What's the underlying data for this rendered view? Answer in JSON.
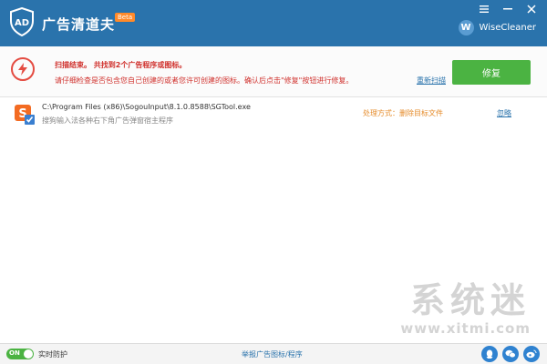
{
  "app": {
    "title": "广告清道夫",
    "badge": "Beta",
    "brand": "WiseCleaner",
    "brand_initial": "W"
  },
  "alert": {
    "headline": "扫描结束。 共找到2个广告程序或图标。",
    "detail": "请仔细检查是否包含您自己创建的或者您许可创建的图标。确认后点击\"修复\"按钮进行修复。",
    "rescan_label": "重新扫描",
    "fix_label": "修复"
  },
  "results": [
    {
      "path": "C:\\Program Files (x86)\\SogouInput\\8.1.0.8588\\SGTool.exe",
      "desc": "搜狗输入法各种右下角广告弹窗宿主程序",
      "action": "处理方式：删除目标文件",
      "ignore_label": "忽略"
    }
  ],
  "watermark": {
    "text": "系统迷",
    "url": "www.xitmi.com"
  },
  "footer": {
    "toggle_label": "ON",
    "realtime_label": "实时防护",
    "report_label": "举报广告图标/程序"
  },
  "colors": {
    "titlebar": "#2a73ac",
    "fix_button": "#4bb342",
    "alert_text": "#d0312d",
    "action_text": "#e58b2a"
  }
}
